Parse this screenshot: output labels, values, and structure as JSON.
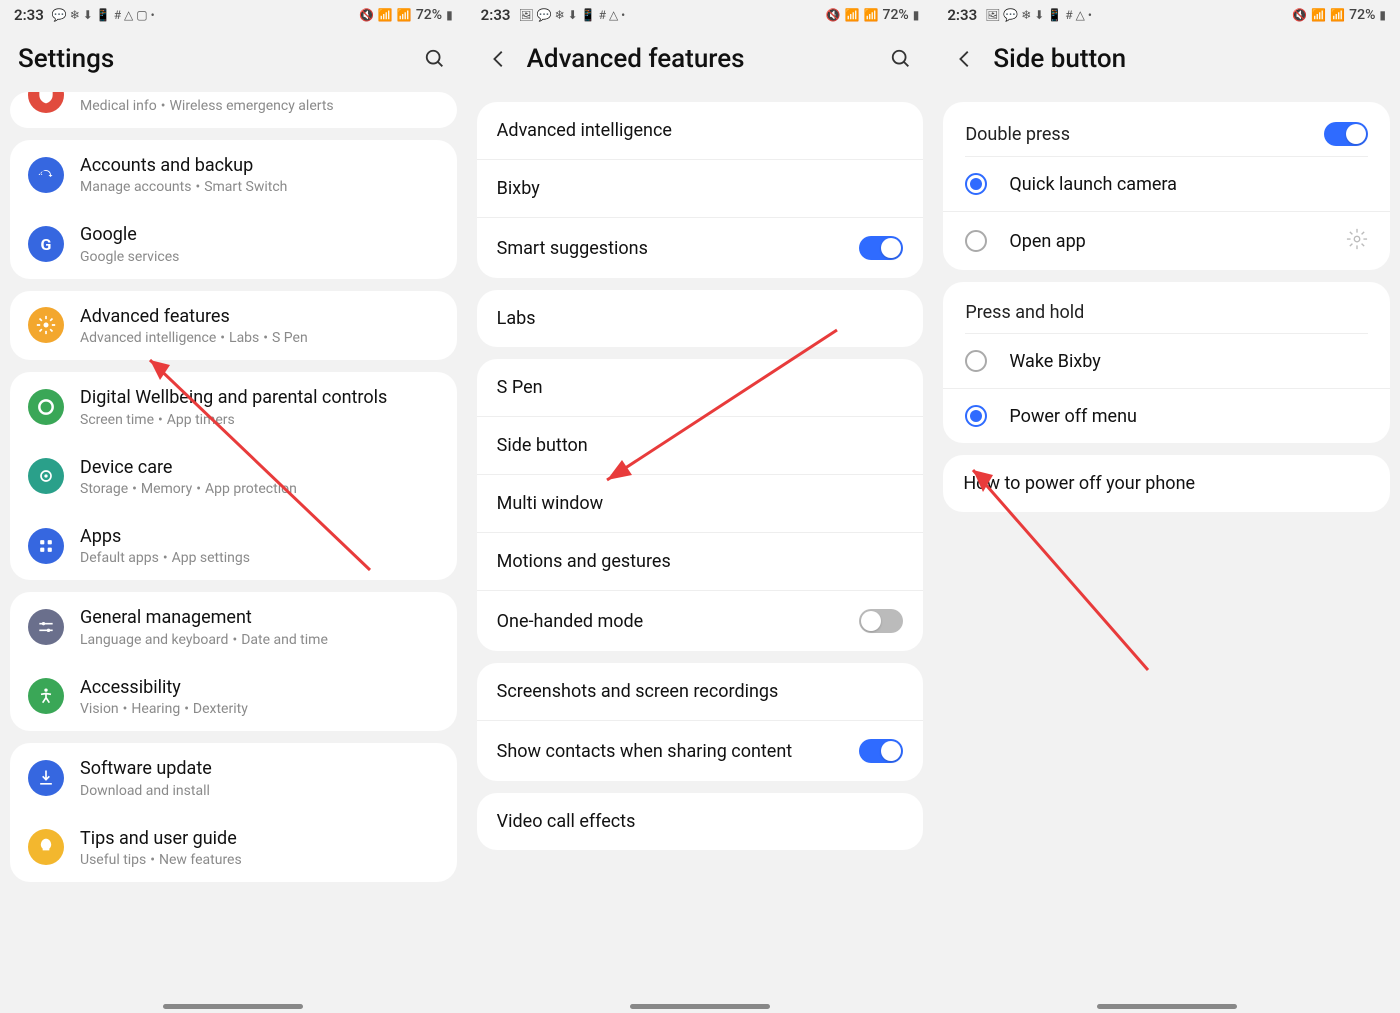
{
  "status": {
    "time": "2:33",
    "battery": "72%"
  },
  "screen1": {
    "title": "Settings",
    "rows": {
      "safety_sub1": "Medical info",
      "safety_sub2": "Wireless emergency alerts",
      "accounts_title": "Accounts and backup",
      "accounts_sub1": "Manage accounts",
      "accounts_sub2": "Smart Switch",
      "google_title": "Google",
      "google_sub": "Google services",
      "advanced_title": "Advanced features",
      "advanced_sub1": "Advanced intelligence",
      "advanced_sub2": "Labs",
      "advanced_sub3": "S Pen",
      "wellbeing_title": "Digital Wellbeing and parental controls",
      "wellbeing_sub1": "Screen time",
      "wellbeing_sub2": "App timers",
      "devicecare_title": "Device care",
      "devicecare_sub1": "Storage",
      "devicecare_sub2": "Memory",
      "devicecare_sub3": "App protection",
      "apps_title": "Apps",
      "apps_sub1": "Default apps",
      "apps_sub2": "App settings",
      "general_title": "General management",
      "general_sub1": "Language and keyboard",
      "general_sub2": "Date and time",
      "accessibility_title": "Accessibility",
      "accessibility_sub1": "Vision",
      "accessibility_sub2": "Hearing",
      "accessibility_sub3": "Dexterity",
      "software_title": "Software update",
      "software_sub": "Download and install",
      "tips_title": "Tips and user guide",
      "tips_sub1": "Useful tips",
      "tips_sub2": "New features"
    }
  },
  "screen2": {
    "title": "Advanced features",
    "items": {
      "advanced_intelligence": "Advanced intelligence",
      "bixby": "Bixby",
      "smart_suggestions": "Smart suggestions",
      "labs": "Labs",
      "s_pen": "S Pen",
      "side_button": "Side button",
      "multi_window": "Multi window",
      "motions": "Motions and gestures",
      "one_handed": "One-handed mode",
      "screenshots": "Screenshots and screen recordings",
      "show_contacts": "Show contacts when sharing content",
      "video_call": "Video call effects"
    },
    "toggles": {
      "smart_suggestions": true,
      "one_handed": false,
      "show_contacts": true
    }
  },
  "screen3": {
    "title": "Side button",
    "double_press": {
      "header": "Double press",
      "toggle": true,
      "quick_launch": "Quick launch camera",
      "open_app": "Open app",
      "selected": "quick_launch"
    },
    "press_hold": {
      "header": "Press and hold",
      "wake_bixby": "Wake Bixby",
      "power_off": "Power off menu",
      "selected": "power_off"
    },
    "how_to": "How to power off your phone"
  }
}
